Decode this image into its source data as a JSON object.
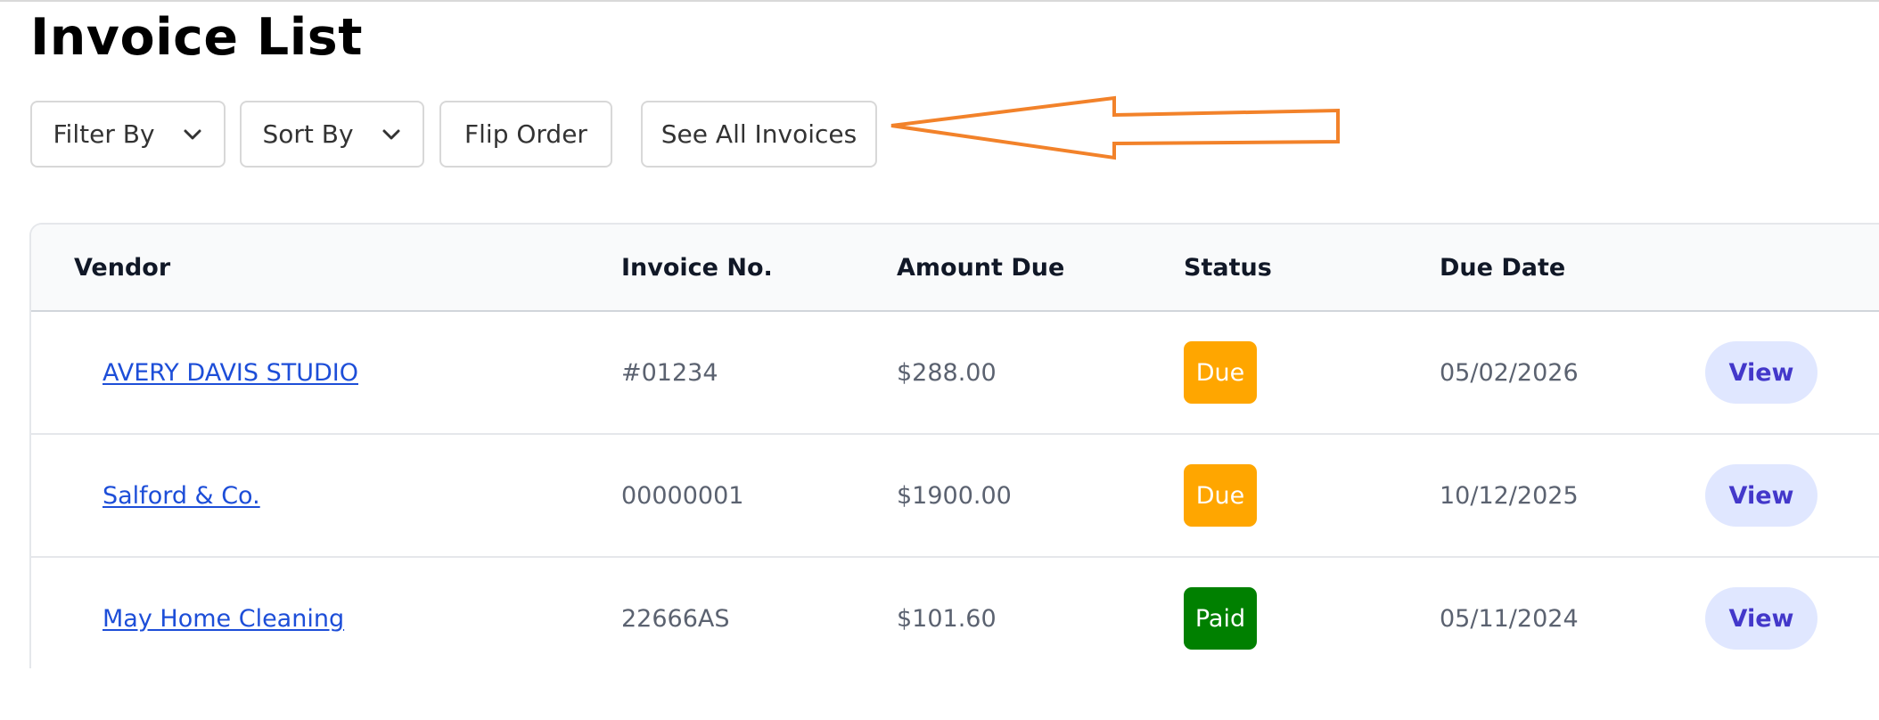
{
  "page": {
    "title": "Invoice List"
  },
  "toolbar": {
    "filter_label": "Filter By",
    "sort_label": "Sort By",
    "flip_label": "Flip Order",
    "see_all_label": "See All Invoices"
  },
  "annotation": {
    "arrow_color": "#f2822a"
  },
  "table": {
    "headers": {
      "vendor": "Vendor",
      "invoice_no": "Invoice No.",
      "amount_due": "Amount Due",
      "status": "Status",
      "due_date": "Due Date"
    },
    "rows": [
      {
        "vendor": "AVERY DAVIS STUDIO",
        "invoice_no": "#01234",
        "amount_due": "$288.00",
        "status": "Due",
        "status_color": "#ffa600",
        "due_date": "05/02/2026",
        "action": "View"
      },
      {
        "vendor": "Salford & Co.",
        "invoice_no": "00000001",
        "amount_due": "$1900.00",
        "status": "Due",
        "status_color": "#ffa600",
        "due_date": "10/12/2025",
        "action": "View"
      },
      {
        "vendor": "May Home Cleaning",
        "invoice_no": "22666AS",
        "amount_due": "$101.60",
        "status": "Paid",
        "status_color": "#008000",
        "due_date": "05/11/2024",
        "action": "View"
      }
    ]
  },
  "icons": {
    "filter_chevron": "chevron-down-icon",
    "sort_chevron": "chevron-down-icon",
    "annotation_arrow": "left-arrow-icon"
  }
}
